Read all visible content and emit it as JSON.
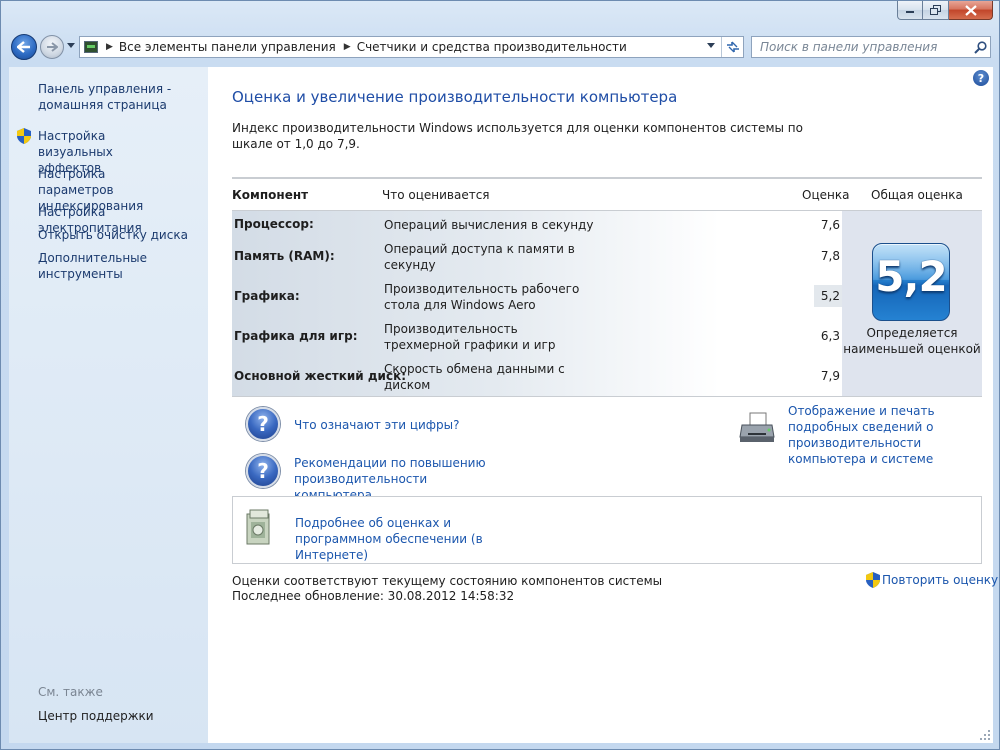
{
  "window": {
    "caption_buttons": [
      "minimize",
      "maximize",
      "close"
    ]
  },
  "address_bar": {
    "breadcrumbs": [
      "Все элементы панели управления",
      "Счетчики и средства производительности"
    ]
  },
  "search": {
    "placeholder": "Поиск в панели управления"
  },
  "sidebar": {
    "home_link": "Панель управления - домашняя страница",
    "items": [
      {
        "label": "Настройка визуальных эффектов",
        "shield": true
      },
      {
        "label": "Настройка параметров индексирования",
        "shield": false
      },
      {
        "label": "Настройка электропитания",
        "shield": false
      },
      {
        "label": "Открыть очистку диска",
        "shield": false
      },
      {
        "label": "Дополнительные инструменты",
        "shield": false
      }
    ],
    "see_also": "См. также",
    "support_link": "Центр поддержки"
  },
  "main": {
    "title": "Оценка и увеличение производительности компьютера",
    "intro": "Индекс производительности Windows используется для оценки компонентов системы по шкале от 1,0 до 7,9.",
    "table": {
      "headers": {
        "component": "Компонент",
        "what": "Что оценивается",
        "score": "Оценка",
        "total": "Общая оценка"
      },
      "rows": [
        {
          "component": "Процессор:",
          "what": "Операций вычисления в секунду",
          "score": "7,6"
        },
        {
          "component": "Память (RAM):",
          "what": "Операций доступа к памяти в секунду",
          "score": "7,8"
        },
        {
          "component": "Графика:",
          "what": "Производительность рабочего стола для Windows Aero",
          "score": "5,2"
        },
        {
          "component": "Графика для игр:",
          "what": "Производительность трехмерной графики и игр",
          "score": "6,3"
        },
        {
          "component": "Основной жесткий диск:",
          "what": "Скорость обмена данными с диском",
          "score": "7,9"
        }
      ],
      "total_score": "5,2",
      "total_caption": "Определяется наименьшей оценкой"
    },
    "links": {
      "what_numbers": "Что означают эти цифры?",
      "recommendations": "Рекомендации по повышению производительности компьютера.",
      "print_details": "Отображение и печать подробных сведений о производительности компьютера и системе",
      "online_info": "Подробнее об оценках и программном обеспечении (в Интернете)"
    },
    "status": {
      "line1": "Оценки соответствуют текущему состоянию компонентов системы",
      "line2": "Последнее обновление: 30.08.2012 14:58:32"
    },
    "rerun": "Повторить оценку"
  }
}
